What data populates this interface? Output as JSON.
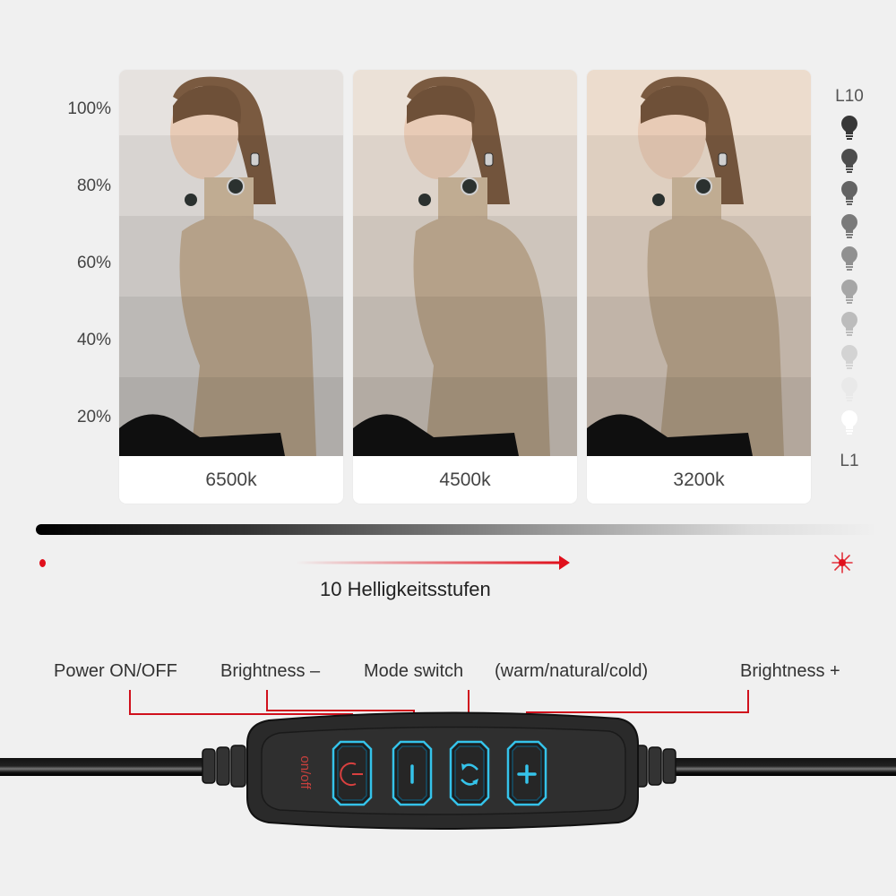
{
  "brightness_axis": [
    "100%",
    "80%",
    "60%",
    "40%",
    "20%"
  ],
  "color_temperatures": [
    {
      "label": "6500k",
      "tone": "#e6e2df"
    },
    {
      "label": "4500k",
      "tone": "#ebe1d7"
    },
    {
      "label": "3200k",
      "tone": "#ecdccd"
    }
  ],
  "brightness_bands_overlay_opacity": [
    0,
    0.06,
    0.12,
    0.18,
    0.24
  ],
  "levels": {
    "top_label": "L10",
    "bottom_label": "L1",
    "count": 10
  },
  "steps_caption": "10 Helligkeitsstufen",
  "controls": {
    "power_label": "Power ON/OFF",
    "brightness_minus_label": "Brightness –",
    "mode_label": "Mode switch",
    "mode_options_label": "(warm/natural/cold)",
    "brightness_plus_label": "Brightness +",
    "remote_text": "on/off"
  },
  "colors": {
    "accent_red": "#e0101c",
    "button_blue": "#35c3ea",
    "power_red": "#d8403f"
  }
}
